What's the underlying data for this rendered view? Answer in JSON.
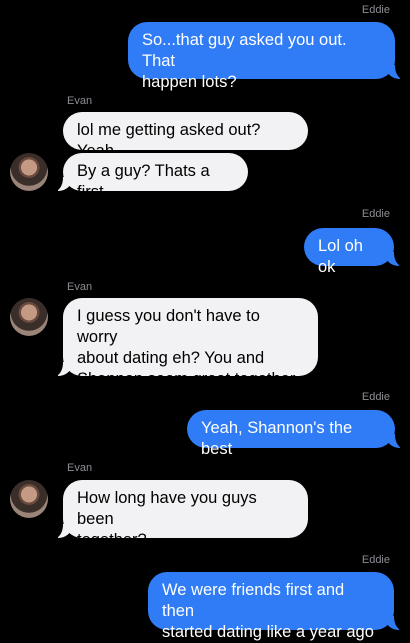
{
  "colors": {
    "background": "#000000",
    "sender_bubble": "#2f7cf6",
    "receiver_bubble": "#f2f2f4",
    "name_label": "#8d8d93"
  },
  "messages": [
    {
      "sender": "Eddie",
      "direction": "outgoing",
      "text": "So...that guy asked you out. That\nhappen lots?"
    },
    {
      "sender": "Evan",
      "direction": "incoming",
      "text": "lol me getting asked out? Yeah"
    },
    {
      "sender": "Evan",
      "direction": "incoming",
      "text": "By a guy? Thats a first"
    },
    {
      "sender": "Eddie",
      "direction": "outgoing",
      "text": "Lol oh ok"
    },
    {
      "sender": "Evan",
      "direction": "incoming",
      "text": "I guess you don't have to worry\nabout dating eh? You and\nShannon seem great together."
    },
    {
      "sender": "Eddie",
      "direction": "outgoing",
      "text": "Yeah, Shannon's the best"
    },
    {
      "sender": "Evan",
      "direction": "incoming",
      "text": "How long have you guys been\ntogether?"
    },
    {
      "sender": "Eddie",
      "direction": "outgoing",
      "text": "We were friends first and then\nstarted dating like a year ago"
    }
  ],
  "avatar_icon": "contact-photo"
}
